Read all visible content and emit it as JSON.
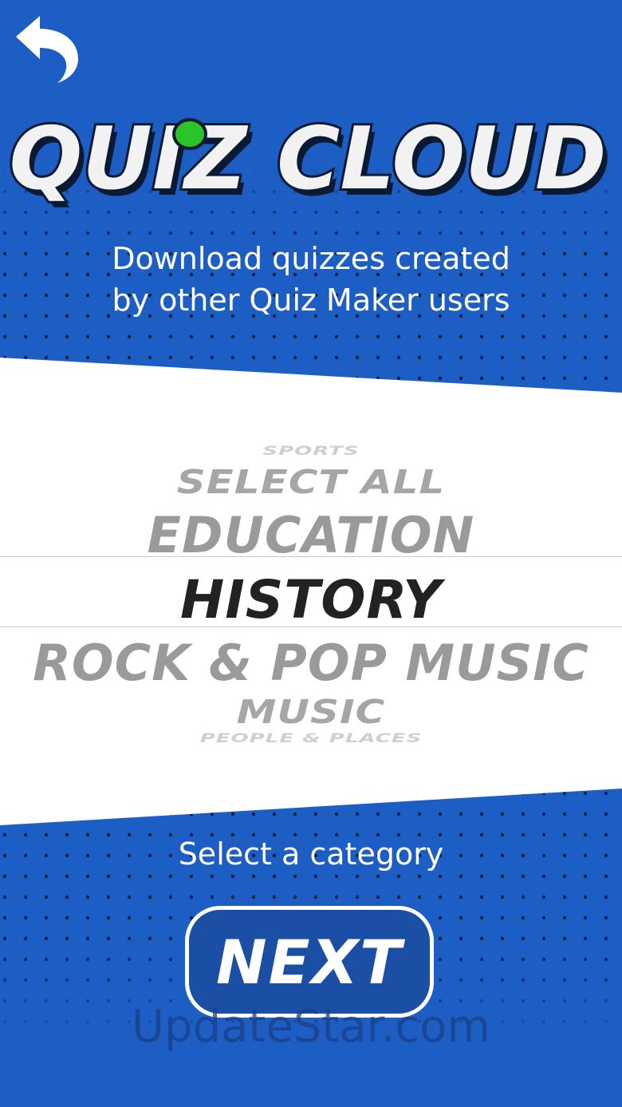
{
  "colors": {
    "background": "#1d5ec4",
    "panel": "#ffffff",
    "accent_green": "#2bc42b",
    "selected_text": "#222222",
    "unselected_text": "#9a9a9a"
  },
  "header": {
    "back_icon": "curved-back-arrow-icon",
    "title": "QUIZ CLOUD",
    "subtitle_line1": "Download quizzes created",
    "subtitle_line2": "by other Quiz Maker users"
  },
  "picker": {
    "items": [
      "SPORTS",
      "SELECT ALL",
      "EDUCATION",
      "HISTORY",
      "ROCK & POP MUSIC",
      "MUSIC",
      "PEOPLE & PLACES"
    ],
    "selected": "HISTORY"
  },
  "footer": {
    "label": "Select a category",
    "next_label": "NEXT"
  },
  "watermark": "UpdateStar.com"
}
